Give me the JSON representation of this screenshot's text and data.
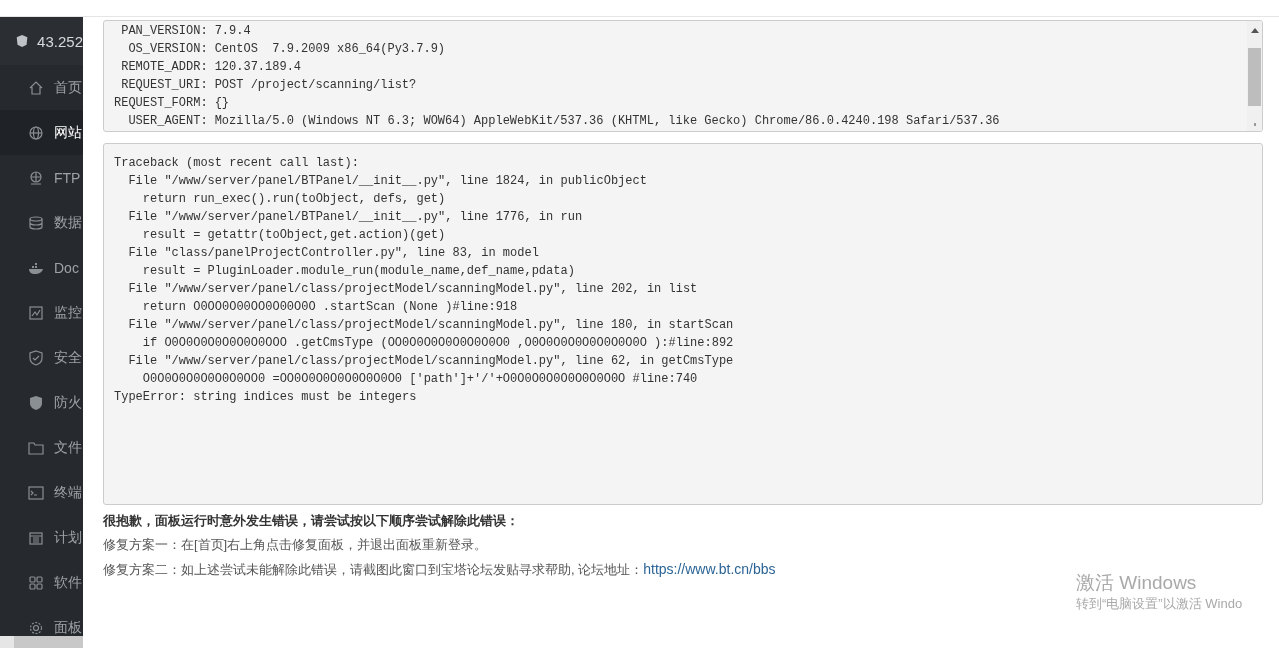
{
  "sidebar": {
    "server_name": "43.252",
    "items": [
      {
        "label": "首页",
        "selected": false
      },
      {
        "label": "网站",
        "selected": true
      },
      {
        "label": "FTP",
        "selected": false
      },
      {
        "label": "数据",
        "selected": false
      },
      {
        "label": "Doc",
        "selected": false
      },
      {
        "label": "监控",
        "selected": false
      },
      {
        "label": "安全",
        "selected": false
      },
      {
        "label": "防火",
        "selected": false
      },
      {
        "label": "文件",
        "selected": false
      },
      {
        "label": "终端",
        "selected": false
      },
      {
        "label": "计划",
        "selected": false
      },
      {
        "label": "软件",
        "selected": false
      },
      {
        "label": "面板",
        "selected": false
      }
    ]
  },
  "info_panel": {
    "rows": [
      {
        "key": "PAN_VERSION:",
        "value": "7.9.4"
      },
      {
        "key": "OS_VERSION:",
        "value": "CentOS  7.9.2009 x86_64(Py3.7.9)"
      },
      {
        "key": "REMOTE_ADDR:",
        "value": "120.37.189.4"
      },
      {
        "key": "REQUEST_URI:",
        "value": "POST /project/scanning/list?"
      },
      {
        "key": "REQUEST_FORM:",
        "value": "{}"
      },
      {
        "key": "USER_AGENT:",
        "value": "Mozilla/5.0 (Windows NT 6.3; WOW64) AppleWebKit/537.36 (KHTML, like Gecko) Chrome/86.0.4240.198 Safari/537.36"
      }
    ]
  },
  "traceback": {
    "lines": [
      "Traceback (most recent call last):",
      "  File \"/www/server/panel/BTPanel/__init__.py\", line 1824, in publicObject",
      "    return run_exec().run(toObject, defs, get)",
      "  File \"/www/server/panel/BTPanel/__init__.py\", line 1776, in run",
      "    result = getattr(toObject,get.action)(get)",
      "  File \"class/panelProjectController.py\", line 83, in model",
      "    result = PluginLoader.module_run(module_name,def_name,pdata)",
      "  File \"/www/server/panel/class/projectModel/scanningModel.py\", line 202, in list",
      "    return O0OO0O00OO0O00O0O .startScan (None )#line:918",
      "  File \"/www/server/panel/class/projectModel/scanningModel.py\", line 180, in startScan",
      "    if O0O0O0O0O0O0O0OOO .getCmsType (OO0O0O0O0O0O0O0O0 ,O0O0O0O0O0O0O0O0O ):#line:892",
      "  File \"/www/server/panel/class/projectModel/scanningModel.py\", line 62, in getCmsType",
      "    O0O0O0O0O0O0O0OO0 =OO0O0O0O0O0O0O0O0 ['path']+'/'+O0O0O0O0O0O0O0O0O #line:740",
      "TypeError: string indices must be integers"
    ]
  },
  "help": {
    "heading": "很抱歉，面板运行时意外发生错误，请尝试按以下顺序尝试解除此错误：",
    "option_1": "修复方案一：在[首页]右上角点击修复面板，并退出面板重新登录。",
    "option_2": "修复方案二：如上述尝试未能解除此错误，请截图此窗口到宝塔论坛发贴寻求帮助, 论坛地址：",
    "forum_link": "https://www.bt.cn/bbs"
  },
  "activation_notice": {
    "title": "激活 Windows",
    "subtitle": "转到“电脑设置”以激活 Windo"
  }
}
